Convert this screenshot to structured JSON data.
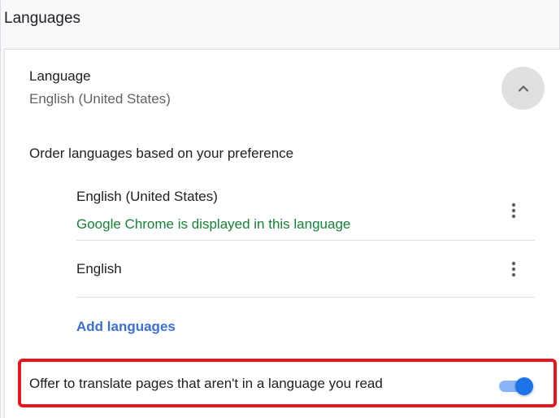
{
  "section": {
    "title": "Languages"
  },
  "language": {
    "label": "Language",
    "value": "English (United States)",
    "expand_icon": "chevron-up-icon"
  },
  "order": {
    "label": "Order languages based on your preference",
    "items": [
      {
        "name": "English (United States)",
        "sub": "Google Chrome is displayed in this language",
        "menu_icon": "more-vert-icon"
      },
      {
        "name": "English",
        "menu_icon": "more-vert-icon"
      }
    ]
  },
  "add_languages": {
    "label": "Add languages"
  },
  "translate": {
    "label": "Offer to translate pages that aren't in a language you read",
    "enabled": true
  },
  "colors": {
    "accent": "#1a73e8",
    "link": "#3c6fd4",
    "success_text": "#188038",
    "highlight_border": "#e8141b"
  }
}
